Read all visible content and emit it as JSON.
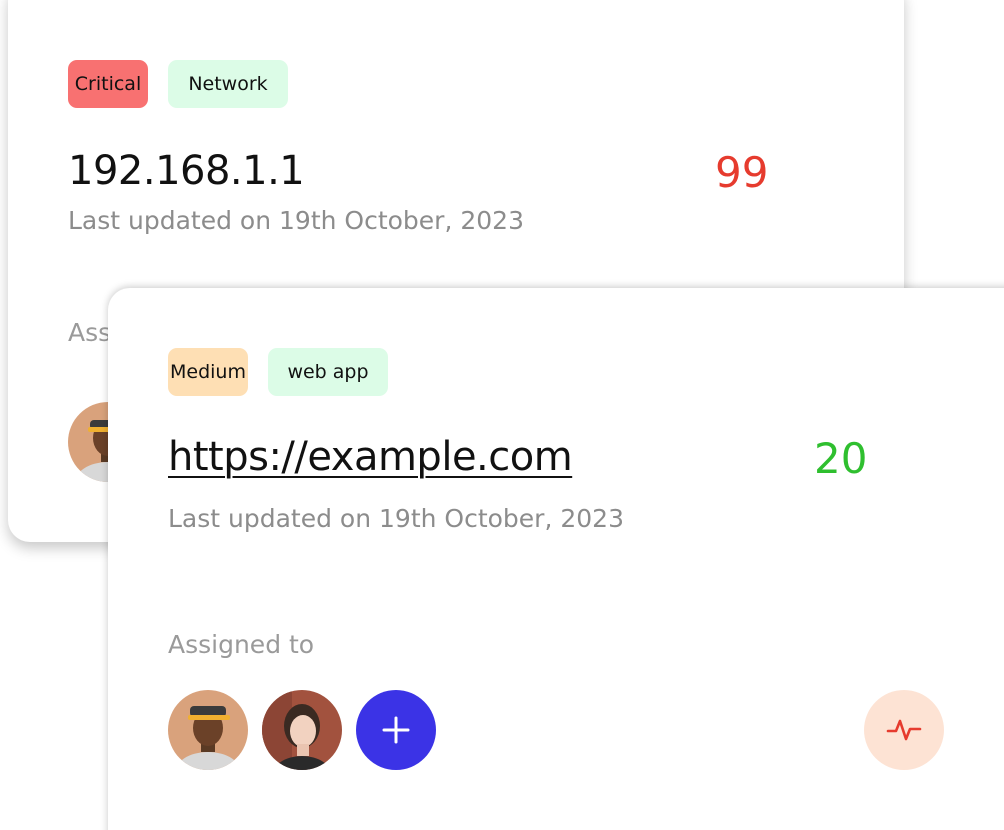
{
  "back_card": {
    "tags": [
      {
        "label": "Critical",
        "color": "#f87171"
      },
      {
        "label": "Network",
        "color": "#dcfce7"
      }
    ],
    "title": "192.168.1.1",
    "score": "99",
    "score_color": "#e63b2e",
    "updated": "Last updated on 19th October, 2023",
    "assigned_label": "Assigned to"
  },
  "front_card": {
    "tags": [
      {
        "label": "Medium",
        "color": "#fedfb4"
      },
      {
        "label": "web app",
        "color": "#dcfce7"
      }
    ],
    "title": "https://example.com",
    "score": "20",
    "score_color": "#2fbf2f",
    "updated": "Last updated on 19th October, 2023",
    "assigned_label": "Assigned to",
    "assignees": [
      {
        "icon": "avatar-man-cap"
      },
      {
        "icon": "avatar-woman"
      }
    ],
    "add_icon": "plus-icon",
    "action_icon": "activity-icon",
    "accent": "#3b33e6"
  }
}
